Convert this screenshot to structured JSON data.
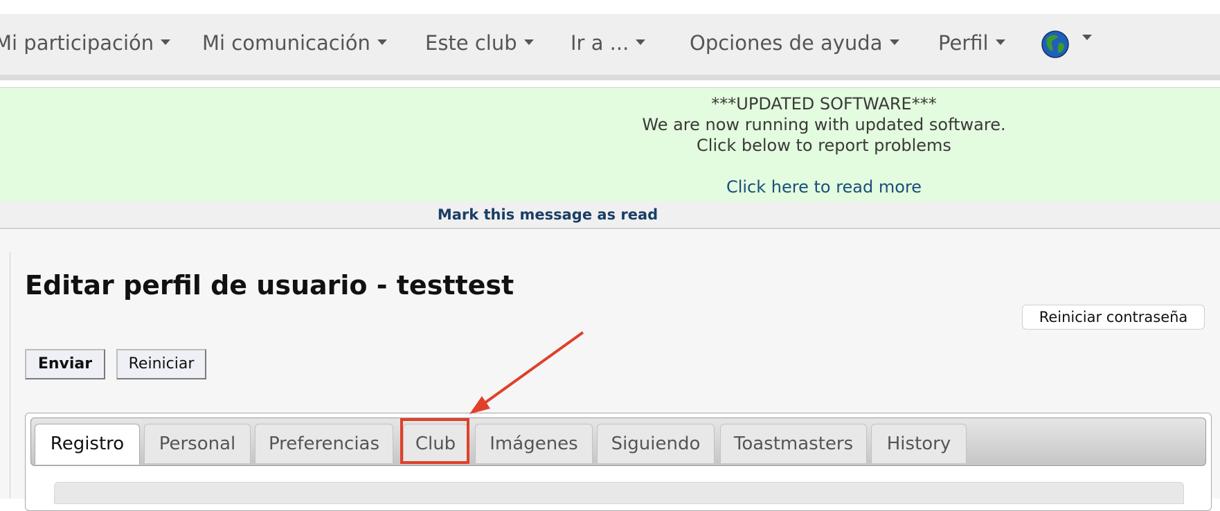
{
  "nav": {
    "items": [
      {
        "label": "Mi participación"
      },
      {
        "label": "Mi comunicación"
      },
      {
        "label": "Este club"
      },
      {
        "label": "Ir a ..."
      },
      {
        "label": "Opciones de ayuda"
      },
      {
        "label": "Perfil"
      }
    ],
    "language_icon": "globe-icon"
  },
  "banner": {
    "line1": "***UPDATED SOFTWARE***",
    "line2": "We are now running with updated software.",
    "line3": "Click below to report problems",
    "link": "Click here to read more",
    "mark_read": "Mark this message as read",
    "background_color": "#e3fbde"
  },
  "page": {
    "title": "Editar perfil de usuario - testtest",
    "reset_password": "Reiniciar contraseña",
    "submit": "Enviar",
    "reset": "Reiniciar"
  },
  "tabs": [
    {
      "label": "Registro",
      "active": true
    },
    {
      "label": "Personal"
    },
    {
      "label": "Preferencias"
    },
    {
      "label": "Club",
      "highlighted": true
    },
    {
      "label": "Imágenes"
    },
    {
      "label": "Siguiendo"
    },
    {
      "label": "Toastmasters"
    },
    {
      "label": "History"
    }
  ],
  "annotation": {
    "color": "#e0402a",
    "target": "Club"
  }
}
